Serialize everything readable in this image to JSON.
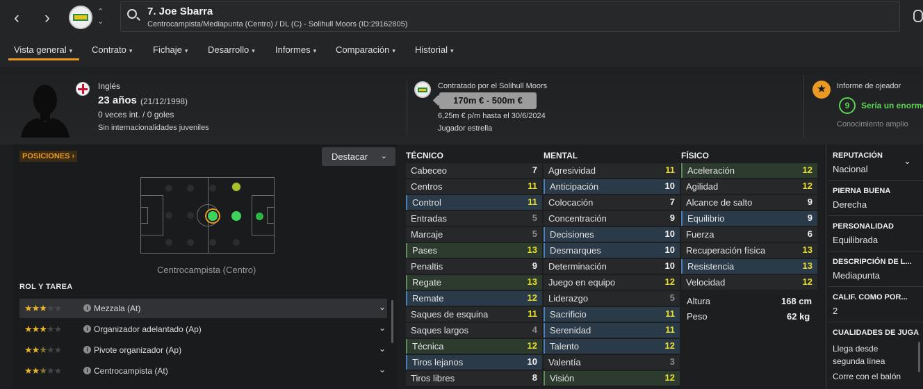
{
  "player": {
    "title": "7. Joe Sbarra",
    "subtitle": "Centrocampista/Mediapunta (Centro) / DL (C) - Solihull Moors (ID:29162805)"
  },
  "tabs": [
    {
      "label": "Vista general"
    },
    {
      "label": "Contrato"
    },
    {
      "label": "Fichaje"
    },
    {
      "label": "Desarrollo"
    },
    {
      "label": "Informes"
    },
    {
      "label": "Comparación"
    },
    {
      "label": "Historial"
    }
  ],
  "bio": {
    "nationality": "Inglés",
    "age": "23 años",
    "dob": "(21/12/1998)",
    "caps": "0 veces int. / 0 goles",
    "youth": "Sin internacionalidades juveniles"
  },
  "contract": {
    "club": "Contratado por el Solihull Moors",
    "value": "170m € - 500m €",
    "wage": "6,25m € p/m hasta el 30/6/2024",
    "status": "Jugador estrella"
  },
  "scout": {
    "title": "Informe de ojeador",
    "rating": "9",
    "comment": "Sería un enorme",
    "knowledge": "Conocimiento amplio"
  },
  "positions": {
    "link": "POSICIONES",
    "highlight_button": "Destacar",
    "caption": "Centrocampista (Centro)"
  },
  "roles": {
    "title": "ROL Y TAREA",
    "items": [
      {
        "label": "Mezzala (At)",
        "stars": 3
      },
      {
        "label": "Organizador adelantado (Ap)",
        "stars": 3
      },
      {
        "label": "Pivote organizador (Ap)",
        "stars": 2.5
      },
      {
        "label": "Centrocampista (At)",
        "stars": 2.5
      }
    ]
  },
  "tecnico": {
    "title": "TÉCNICO",
    "attrs": [
      {
        "name": "Cabeceo",
        "value": "7"
      },
      {
        "name": "Centros",
        "value": "11"
      },
      {
        "name": "Control",
        "value": "11"
      },
      {
        "name": "Entradas",
        "value": "5"
      },
      {
        "name": "Marcaje",
        "value": "5"
      },
      {
        "name": "Pases",
        "value": "13"
      },
      {
        "name": "Penaltis",
        "value": "9"
      },
      {
        "name": "Regate",
        "value": "13"
      },
      {
        "name": "Remate",
        "value": "12"
      },
      {
        "name": "Saques de esquina",
        "value": "11"
      },
      {
        "name": "Saques largos",
        "value": "4"
      },
      {
        "name": "Técnica",
        "value": "12"
      },
      {
        "name": "Tiros lejanos",
        "value": "10"
      },
      {
        "name": "Tiros libres",
        "value": "8"
      }
    ]
  },
  "mental": {
    "title": "MENTAL",
    "attrs": [
      {
        "name": "Agresividad",
        "value": "11"
      },
      {
        "name": "Anticipación",
        "value": "10"
      },
      {
        "name": "Colocación",
        "value": "7"
      },
      {
        "name": "Concentración",
        "value": "9"
      },
      {
        "name": "Decisiones",
        "value": "10"
      },
      {
        "name": "Desmarques",
        "value": "10"
      },
      {
        "name": "Determinación",
        "value": "10"
      },
      {
        "name": "Juego en equipo",
        "value": "12"
      },
      {
        "name": "Liderazgo",
        "value": "5"
      },
      {
        "name": "Sacrificio",
        "value": "11"
      },
      {
        "name": "Serenidad",
        "value": "11"
      },
      {
        "name": "Talento",
        "value": "12"
      },
      {
        "name": "Valentía",
        "value": "3"
      },
      {
        "name": "Visión",
        "value": "12"
      }
    ]
  },
  "fisico": {
    "title": "FÍSICO",
    "attrs": [
      {
        "name": "Aceleración",
        "value": "12"
      },
      {
        "name": "Agilidad",
        "value": "12"
      },
      {
        "name": "Alcance de salto",
        "value": "9"
      },
      {
        "name": "Equilibrio",
        "value": "9"
      },
      {
        "name": "Fuerza",
        "value": "6"
      },
      {
        "name": "Recuperación física",
        "value": "13"
      },
      {
        "name": "Resistencia",
        "value": "13"
      },
      {
        "name": "Velocidad",
        "value": "12"
      }
    ],
    "height_label": "Altura",
    "height": "168 cm",
    "weight_label": "Peso",
    "weight": "62 kg"
  },
  "side": {
    "reputation_title": "REPUTACIÓN",
    "reputation": "Nacional",
    "foot_title": "PIERNA BUENA",
    "foot": "Derecha",
    "personality_title": "PERSONALIDAD",
    "personality": "Equilibrada",
    "description_title": "DESCRIPCIÓN DE L...",
    "description": "Mediapunta",
    "rating_title": "CALIF. COMO POR...",
    "rating": "2",
    "qualities_title": "CUALIDADES DE JUGA",
    "quality_1a": "Llega desde",
    "quality_1b": "segunda línea",
    "quality_2": "Corre con el balón"
  },
  "colors": {
    "accent": "#ea9a23",
    "good": "#5bd453",
    "value_yellow": "#e8df2a"
  }
}
